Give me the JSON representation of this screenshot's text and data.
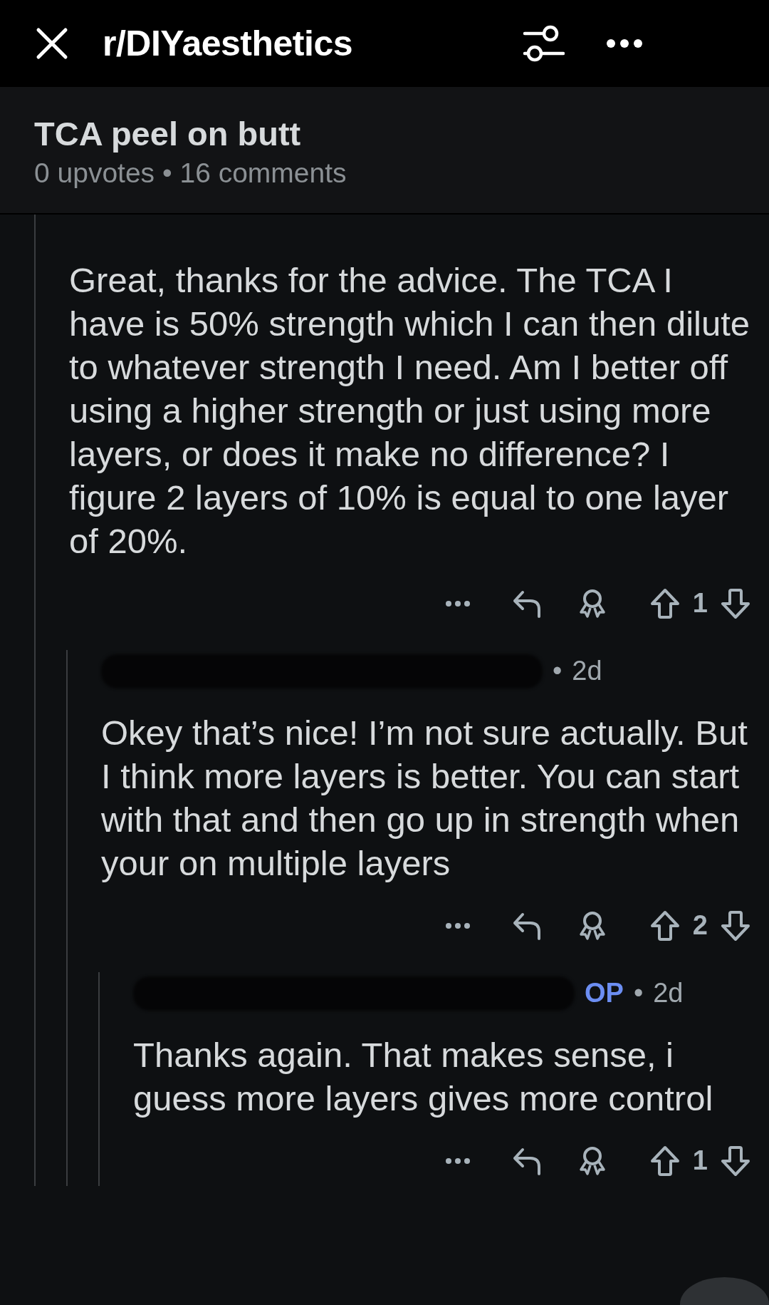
{
  "header": {
    "title": "r/DIYaesthetics"
  },
  "post": {
    "title": "TCA peel on butt",
    "meta": "0 upvotes • 16 comments"
  },
  "comments": [
    {
      "body": "Great, thanks for the advice. The TCA I have is 50% strength which I can then dilute to whatever strength I need. Am I better off using a higher strength or just using more layers, or does it make no difference? I figure 2 layers of 10% is equal to one layer of 20%.",
      "votes": "1",
      "children": [
        {
          "separator": "•",
          "time": "2d",
          "body": "Okey that’s nice! I’m not sure actually. But I think more layers is better. You can start with that and then go up in strength when your on multiple layers",
          "votes": "2",
          "children": [
            {
              "op_label": "OP",
              "separator": "•",
              "time": "2d",
              "body": "Thanks again. That makes sense, i guess more layers gives more control",
              "votes": "1"
            }
          ]
        }
      ]
    }
  ]
}
